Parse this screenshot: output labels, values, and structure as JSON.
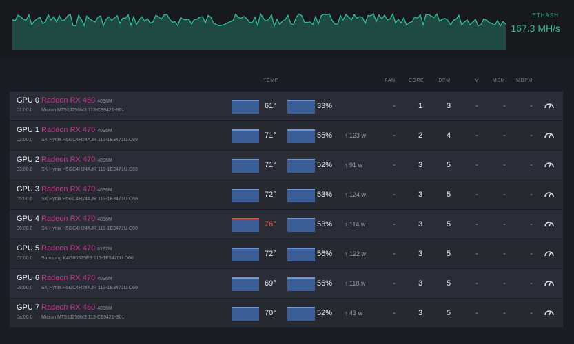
{
  "hashrate": {
    "algorithm": "ETHASH",
    "value": "167.3 MH/s",
    "accent_color": "#2fbf9a"
  },
  "header": {
    "temp": "TEMP",
    "fan": "FAN",
    "core": "CORE",
    "dpm": "DPM",
    "v": "V",
    "mem": "MEM",
    "mdpm": "MDPM"
  },
  "gpus": [
    {
      "id": "GPU 0",
      "bus": "01:00.0",
      "name": "Radeon RX 460",
      "mem_size": "4096M",
      "mem_info": "Micron MT51J256M3 113-C99421-S01",
      "temp": "61°",
      "fan": "33%",
      "power": "",
      "fan_col": "-",
      "core": "1",
      "dpm": "3",
      "v": "-",
      "mem": "-",
      "mdpm": "-",
      "hot": false
    },
    {
      "id": "GPU 1",
      "bus": "02:00.0",
      "name": "Radeon RX 470",
      "mem_size": "4096M",
      "mem_info": "SK Hynix H5GC4H24AJR 113-1E3471U.O69",
      "temp": "71°",
      "fan": "55%",
      "power": "↑ 123 w",
      "fan_col": "-",
      "core": "2",
      "dpm": "4",
      "v": "-",
      "mem": "-",
      "mdpm": "-",
      "hot": false
    },
    {
      "id": "GPU 2",
      "bus": "03:00.0",
      "name": "Radeon RX 470",
      "mem_size": "4096M",
      "mem_info": "SK Hynix H5GC4H24AJR 113-1E3471U.O69",
      "temp": "71°",
      "fan": "52%",
      "power": "↑ 91 w",
      "fan_col": "-",
      "core": "3",
      "dpm": "5",
      "v": "-",
      "mem": "-",
      "mdpm": "-",
      "hot": false
    },
    {
      "id": "GPU 3",
      "bus": "05:00.0",
      "name": "Radeon RX 470",
      "mem_size": "4096M",
      "mem_info": "SK Hynix H5GC4H24AJR 113-1E3471U.O69",
      "temp": "72°",
      "fan": "53%",
      "power": "↑ 124 w",
      "fan_col": "-",
      "core": "3",
      "dpm": "5",
      "v": "-",
      "mem": "-",
      "mdpm": "-",
      "hot": false
    },
    {
      "id": "GPU 4",
      "bus": "06:00.0",
      "name": "Radeon RX 470",
      "mem_size": "4096M",
      "mem_info": "SK Hynix H5GC4H24AJR 113-1E3471U.O69",
      "temp": "76°",
      "fan": "53%",
      "power": "↑ 114 w",
      "fan_col": "-",
      "core": "3",
      "dpm": "5",
      "v": "-",
      "mem": "-",
      "mdpm": "-",
      "hot": true
    },
    {
      "id": "GPU 5",
      "bus": "07:00.0",
      "name": "Radeon RX 470",
      "mem_size": "8192M",
      "mem_info": "Samsung K4G80325FB 113-1E3470U.O60",
      "temp": "72°",
      "fan": "56%",
      "power": "↑ 122 w",
      "fan_col": "-",
      "core": "3",
      "dpm": "5",
      "v": "-",
      "mem": "-",
      "mdpm": "-",
      "hot": false
    },
    {
      "id": "GPU 6",
      "bus": "08:00.0",
      "name": "Radeon RX 470",
      "mem_size": "4096M",
      "mem_info": "SK Hynix H5GC4H24AJR 113-1E3471U.O69",
      "temp": "69°",
      "fan": "56%",
      "power": "↑ 118 w",
      "fan_col": "-",
      "core": "3",
      "dpm": "5",
      "v": "-",
      "mem": "-",
      "mdpm": "-",
      "hot": false
    },
    {
      "id": "GPU 7",
      "bus": "0a:00.0",
      "name": "Radeon RX 460",
      "mem_size": "4096M",
      "mem_info": "Micron MT51J256M3 113-C99421-S01",
      "temp": "70°",
      "fan": "52%",
      "power": "↑ 43 w",
      "fan_col": "-",
      "core": "3",
      "dpm": "5",
      "v": "-",
      "mem": "-",
      "mdpm": "-",
      "hot": false
    }
  ]
}
